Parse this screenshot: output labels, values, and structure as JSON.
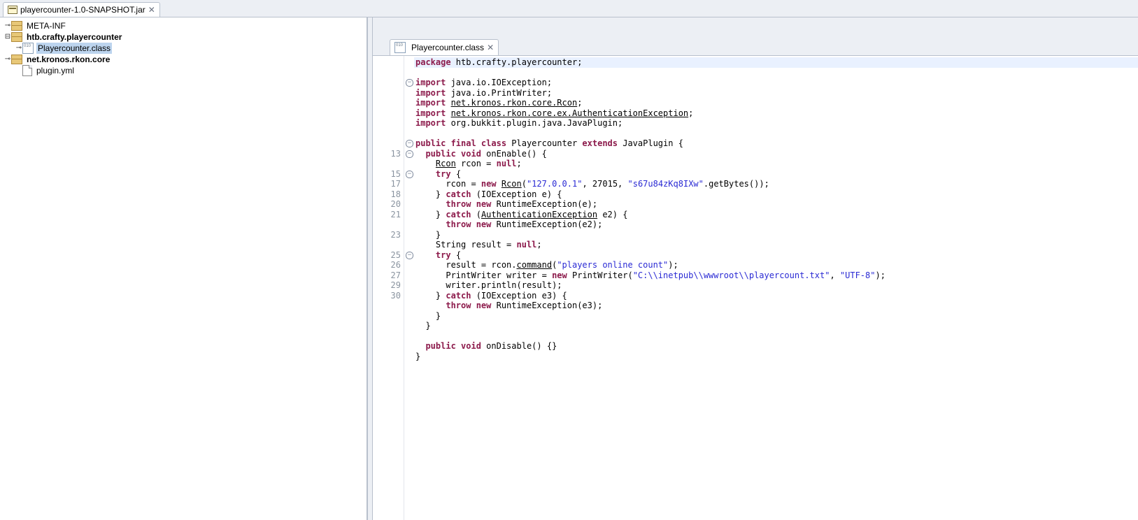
{
  "topTab": {
    "label": "playercounter-1.0-SNAPSHOT.jar",
    "close": "✕"
  },
  "tree": {
    "meta": "META-INF",
    "pkg1": "htb.crafty.playercounter",
    "cls": "Playercounter.class",
    "pkg2": "net.kronos.rkon.core",
    "yml": "plugin.yml"
  },
  "editorTab": {
    "label": "Playercounter.class",
    "close": "✕"
  },
  "gutter": [
    "",
    "",
    "",
    "",
    "",
    "",
    "",
    "",
    "",
    "13",
    "",
    "15",
    "17",
    "18",
    "20",
    "21",
    "",
    "23",
    "",
    "25",
    "26",
    "27",
    "29",
    "30",
    "",
    "",
    "",
    "",
    "",
    ""
  ],
  "code": [
    {
      "hl": true,
      "seg": [
        {
          "c": "kw",
          "t": "package"
        },
        {
          "t": " htb.crafty.playercounter;"
        }
      ]
    },
    {
      "seg": [
        {
          "t": ""
        }
      ]
    },
    {
      "seg": [
        {
          "c": "kw",
          "t": "import"
        },
        {
          "t": " java.io.IOException;"
        }
      ]
    },
    {
      "seg": [
        {
          "c": "kw",
          "t": "import"
        },
        {
          "t": " java.io.PrintWriter;"
        }
      ]
    },
    {
      "seg": [
        {
          "c": "kw",
          "t": "import"
        },
        {
          "t": " "
        },
        {
          "c": "und",
          "t": "net.kronos.rkon.core.Rcon"
        },
        {
          "t": ";"
        }
      ]
    },
    {
      "seg": [
        {
          "c": "kw",
          "t": "import"
        },
        {
          "t": " "
        },
        {
          "c": "und",
          "t": "net.kronos.rkon.core.ex.AuthenticationException"
        },
        {
          "t": ";"
        }
      ]
    },
    {
      "seg": [
        {
          "c": "kw",
          "t": "import"
        },
        {
          "t": " org.bukkit.plugin.java.JavaPlugin;"
        }
      ]
    },
    {
      "seg": [
        {
          "t": ""
        }
      ]
    },
    {
      "seg": [
        {
          "c": "kw",
          "t": "public final class"
        },
        {
          "t": " Playercounter "
        },
        {
          "c": "kw",
          "t": "extends"
        },
        {
          "t": " JavaPlugin {"
        }
      ]
    },
    {
      "seg": [
        {
          "t": "  "
        },
        {
          "c": "kw",
          "t": "public void"
        },
        {
          "t": " onEnable() {"
        }
      ]
    },
    {
      "seg": [
        {
          "t": "    "
        },
        {
          "c": "und",
          "t": "Rcon"
        },
        {
          "t": " rcon = "
        },
        {
          "c": "kw",
          "t": "null"
        },
        {
          "t": ";"
        }
      ]
    },
    {
      "seg": [
        {
          "t": "    "
        },
        {
          "c": "kw",
          "t": "try"
        },
        {
          "t": " {"
        }
      ]
    },
    {
      "seg": [
        {
          "t": "      rcon = "
        },
        {
          "c": "kw",
          "t": "new"
        },
        {
          "t": " "
        },
        {
          "c": "und",
          "t": "Rcon"
        },
        {
          "t": "("
        },
        {
          "c": "str",
          "t": "\"127.0.0.1\""
        },
        {
          "t": ", 27015, "
        },
        {
          "c": "str",
          "t": "\"s67u84zKq8IXw\""
        },
        {
          "t": ".getBytes());"
        }
      ]
    },
    {
      "seg": [
        {
          "t": "    } "
        },
        {
          "c": "kw",
          "t": "catch"
        },
        {
          "t": " (IOException e) {"
        }
      ]
    },
    {
      "seg": [
        {
          "t": "      "
        },
        {
          "c": "kw",
          "t": "throw new"
        },
        {
          "t": " RuntimeException(e);"
        }
      ]
    },
    {
      "seg": [
        {
          "t": "    } "
        },
        {
          "c": "kw",
          "t": "catch"
        },
        {
          "t": " ("
        },
        {
          "c": "und",
          "t": "AuthenticationException"
        },
        {
          "t": " e2) {"
        }
      ]
    },
    {
      "seg": [
        {
          "t": "      "
        },
        {
          "c": "kw",
          "t": "throw new"
        },
        {
          "t": " RuntimeException(e2);"
        }
      ]
    },
    {
      "seg": [
        {
          "t": "    } "
        }
      ]
    },
    {
      "seg": [
        {
          "t": "    String result = "
        },
        {
          "c": "kw",
          "t": "null"
        },
        {
          "t": ";"
        }
      ]
    },
    {
      "seg": [
        {
          "t": "    "
        },
        {
          "c": "kw",
          "t": "try"
        },
        {
          "t": " {"
        }
      ]
    },
    {
      "seg": [
        {
          "t": "      result = rcon."
        },
        {
          "c": "und",
          "t": "command"
        },
        {
          "t": "("
        },
        {
          "c": "str",
          "t": "\"players online count\""
        },
        {
          "t": ");"
        }
      ]
    },
    {
      "seg": [
        {
          "t": "      PrintWriter writer = "
        },
        {
          "c": "kw",
          "t": "new"
        },
        {
          "t": " PrintWriter("
        },
        {
          "c": "str",
          "t": "\"C:\\\\inetpub\\\\wwwroot\\\\playercount.txt\""
        },
        {
          "t": ", "
        },
        {
          "c": "str",
          "t": "\"UTF-8\""
        },
        {
          "t": ");"
        }
      ]
    },
    {
      "seg": [
        {
          "t": "      writer.println(result);"
        }
      ]
    },
    {
      "seg": [
        {
          "t": "    } "
        },
        {
          "c": "kw",
          "t": "catch"
        },
        {
          "t": " (IOException e3) {"
        }
      ]
    },
    {
      "seg": [
        {
          "t": "      "
        },
        {
          "c": "kw",
          "t": "throw new"
        },
        {
          "t": " RuntimeException(e3);"
        }
      ]
    },
    {
      "seg": [
        {
          "t": "    } "
        }
      ]
    },
    {
      "seg": [
        {
          "t": "  }"
        }
      ]
    },
    {
      "seg": [
        {
          "t": "  "
        }
      ]
    },
    {
      "seg": [
        {
          "t": "  "
        },
        {
          "c": "kw",
          "t": "public void"
        },
        {
          "t": " onDisable() {}"
        }
      ]
    },
    {
      "seg": [
        {
          "t": "}"
        }
      ]
    }
  ],
  "foldMarks": [
    {
      "line": 2,
      "sym": "−"
    },
    {
      "line": 8,
      "sym": "−"
    },
    {
      "line": 9,
      "sym": "−"
    },
    {
      "line": 11,
      "sym": "−"
    },
    {
      "line": 19,
      "sym": "−"
    }
  ]
}
